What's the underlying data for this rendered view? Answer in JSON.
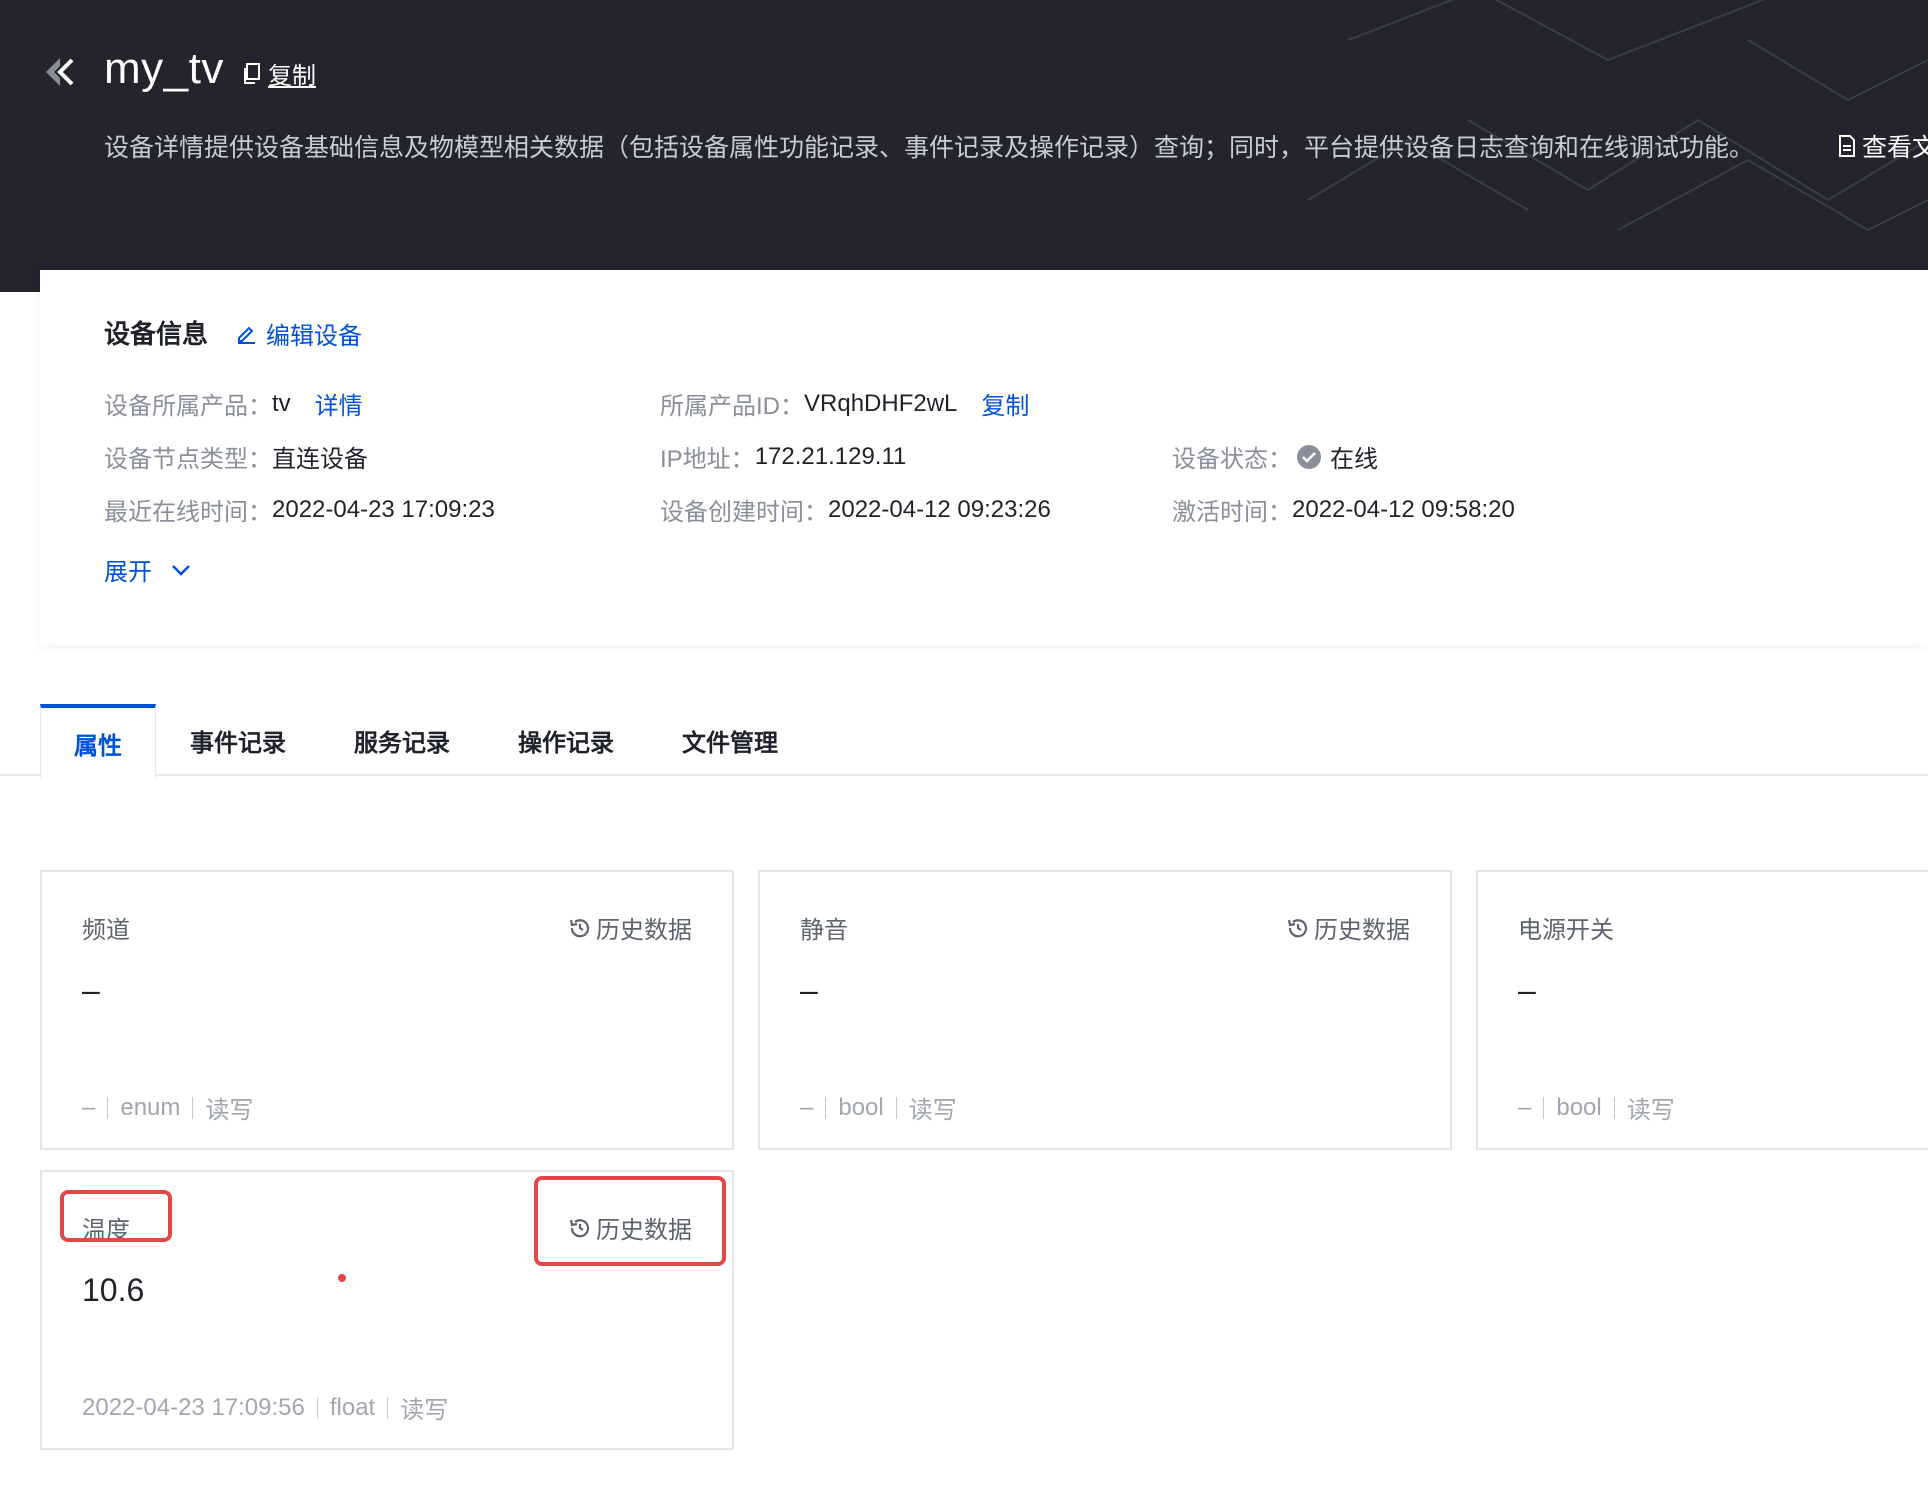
{
  "header": {
    "device_name": "my_tv",
    "copy_label": "复制",
    "description": "设备详情提供设备基础信息及物模型相关数据（包括设备属性功能记录、事件记录及操作记录）查询；同时，平台提供设备日志查询和在线调试功能。",
    "doc_link_label": "查看文"
  },
  "device_info": {
    "title": "设备信息",
    "edit_label": "编辑设备",
    "product": {
      "label": "设备所属产品：",
      "value": "tv",
      "link": "详情"
    },
    "product_id": {
      "label": "所属产品ID：",
      "value": "VRqhDHF2wL",
      "link": "复制"
    },
    "node_type": {
      "label": "设备节点类型：",
      "value": "直连设备"
    },
    "ip": {
      "label": "IP地址：",
      "value": "172.21.129.11"
    },
    "status": {
      "label": "设备状态：",
      "value": "在线"
    },
    "last_online": {
      "label": "最近在线时间：",
      "value": "2022-04-23 17:09:23"
    },
    "created": {
      "label": "设备创建时间：",
      "value": "2022-04-12 09:23:26"
    },
    "activated": {
      "label": "激活时间：",
      "value": "2022-04-12 09:58:20"
    },
    "expand_label": "展开"
  },
  "tabs": [
    "属性",
    "事件记录",
    "服务记录",
    "操作记录",
    "文件管理"
  ],
  "history_label": "历史数据",
  "properties": [
    {
      "name": "频道",
      "value": "–",
      "time": "–",
      "type": "enum",
      "access": "读写"
    },
    {
      "name": "静音",
      "value": "–",
      "time": "–",
      "type": "bool",
      "access": "读写"
    },
    {
      "name": "电源开关",
      "value": "–",
      "time": "–",
      "type": "bool",
      "access": "读写"
    },
    {
      "name": "温度",
      "value": "10.6",
      "time": "2022-04-23 17:09:56",
      "type": "float",
      "access": "读写"
    }
  ],
  "colors": {
    "accent": "#0052d9",
    "header_bg": "#23252b",
    "highlight": "#e04848"
  }
}
